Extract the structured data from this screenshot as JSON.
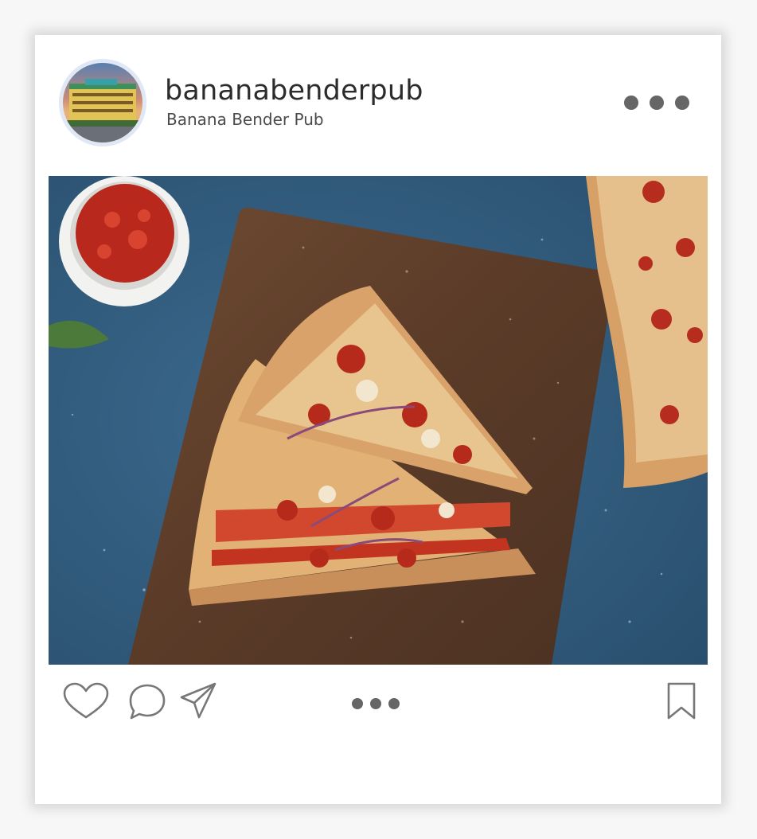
{
  "post": {
    "username": "bananabenderpub",
    "display_name": "Banana Bender Pub"
  },
  "icons": {
    "avatar": "building-photo",
    "more": "more-dots-icon",
    "like": "heart-icon",
    "comment": "comment-bubble-icon",
    "share": "paper-plane-icon",
    "carousel": "carousel-dots-indicator",
    "save": "bookmark-icon"
  },
  "colors": {
    "icon_gray": "#666666",
    "text_dark": "#2c2c2c",
    "avatar_ring": "#dfe8f4"
  }
}
